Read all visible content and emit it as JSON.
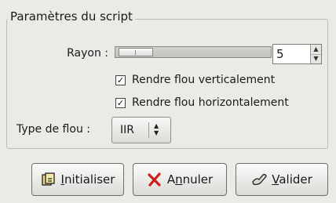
{
  "frame": {
    "title": "Paramètres du script"
  },
  "radius": {
    "label": "Rayon :",
    "value": "5",
    "slider_level": 0.12
  },
  "checkboxes": [
    {
      "label": "Rendre flou verticalement",
      "checked": true
    },
    {
      "label": "Rendre flou horizontalement",
      "checked": true
    }
  ],
  "blur_type": {
    "label": "Type de flou :",
    "selected": "IIR"
  },
  "buttons": {
    "reset": {
      "mnemonic": "I",
      "rest": "nitialiser",
      "icon": "reset-icon"
    },
    "cancel": {
      "prefix": "A",
      "mnemonic": "n",
      "rest": "nuler",
      "icon": "cancel-icon"
    },
    "ok": {
      "mnemonic": "V",
      "rest": "alider",
      "icon": "ok-icon"
    }
  },
  "colors": {
    "background": "#ebebe6",
    "cancel_red": "#d01c1c"
  }
}
